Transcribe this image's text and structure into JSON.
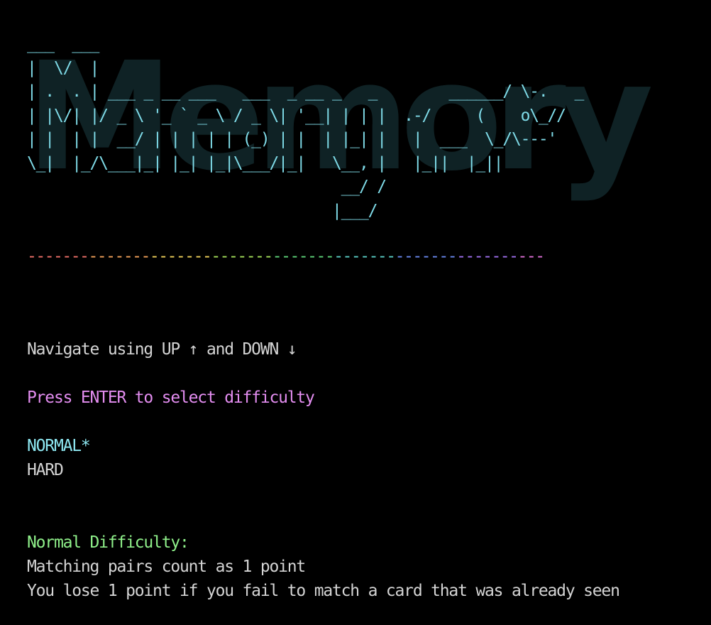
{
  "logo": {
    "ascii_lines": [
      "___  ___",
      "|  \\/  |",
      "| .  . | ___ _ __ ___   ___  _ __ _   _        ______/ \\-.   _",
      "| |\\/| |/ _ \\ '_ ` _ \\ / _ \\| '__| | | |  .-/     (    o\\_//",
      "| |  | |  __/ | | | | | (_) | |  | |_| |   |  ___  \\_/\\---'",
      "\\_|  |_/\\___|_| |_| |_|\\___/|_|   \\__, |   |_||  |_||",
      "                                   __/ /",
      "                                  |___/"
    ],
    "big_word": "Memory"
  },
  "divider": {
    "text": "-----------------------------------------------------------",
    "colors": [
      "#f2716a",
      "#f5a35a",
      "#f0d25a",
      "#a6e05a",
      "#5fd67a",
      "#5ad0c8",
      "#6a8af0",
      "#a070f0",
      "#e070d8"
    ]
  },
  "menu": {
    "navigate_hint": "Navigate using UP ↑ and DOWN ↓",
    "select_prompt": "Press ENTER to select difficulty",
    "options": [
      {
        "label": "NORMAL*"
      },
      {
        "label": "HARD"
      }
    ]
  },
  "description": {
    "title": "Normal Difficulty:",
    "lines": [
      "Matching pairs count as 1 point",
      "You lose 1 point if you fail to match a card that was already seen"
    ]
  },
  "colors": {
    "background": "#000000",
    "logo": "#7fdbe8",
    "prompt": "#e38df0",
    "selected_option": "#8ee8f2",
    "description_title": "#8ff08a",
    "text": "#d4d4d4"
  }
}
